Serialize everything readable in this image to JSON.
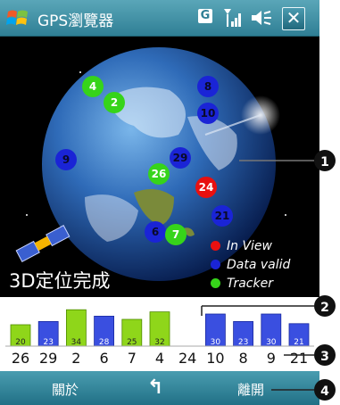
{
  "titlebar": {
    "title": "GPS瀏覽器",
    "tray_g": "G",
    "close_glyph": "✕"
  },
  "sky": {
    "status": "3D定位完成",
    "satellites": [
      {
        "id": "4",
        "state": "tracker"
      },
      {
        "id": "2",
        "state": "tracker"
      },
      {
        "id": "8",
        "state": "data_valid"
      },
      {
        "id": "10",
        "state": "data_valid"
      },
      {
        "id": "9",
        "state": "data_valid"
      },
      {
        "id": "29",
        "state": "data_valid"
      },
      {
        "id": "26",
        "state": "tracker"
      },
      {
        "id": "24",
        "state": "in_view"
      },
      {
        "id": "21",
        "state": "data_valid"
      },
      {
        "id": "6",
        "state": "data_valid"
      },
      {
        "id": "7",
        "state": "tracker"
      }
    ],
    "legend": [
      {
        "label": "In View",
        "color": "#e81010"
      },
      {
        "label": "Data valid",
        "color": "#1a24d6"
      },
      {
        "label": "Tracker",
        "color": "#36d41a"
      }
    ]
  },
  "signal_bars": [
    {
      "prn": "26",
      "snr": "20",
      "color": "green"
    },
    {
      "prn": "29",
      "snr": "23",
      "color": "blue"
    },
    {
      "prn": "2",
      "snr": "34",
      "color": "green"
    },
    {
      "prn": "6",
      "snr": "28",
      "color": "blue"
    },
    {
      "prn": "7",
      "snr": "25",
      "color": "green"
    },
    {
      "prn": "4",
      "snr": "32",
      "color": "green"
    },
    {
      "prn": "24",
      "snr": "",
      "color": "none"
    },
    {
      "prn": "10",
      "snr": "30",
      "color": "blue"
    },
    {
      "prn": "8",
      "snr": "23",
      "color": "blue"
    },
    {
      "prn": "9",
      "snr": "30",
      "color": "blue"
    },
    {
      "prn": "21",
      "snr": "21",
      "color": "blue"
    }
  ],
  "softbar": {
    "left": "關於",
    "middle": "↰",
    "right": "離開"
  },
  "callouts": [
    "1",
    "2",
    "3",
    "4"
  ]
}
